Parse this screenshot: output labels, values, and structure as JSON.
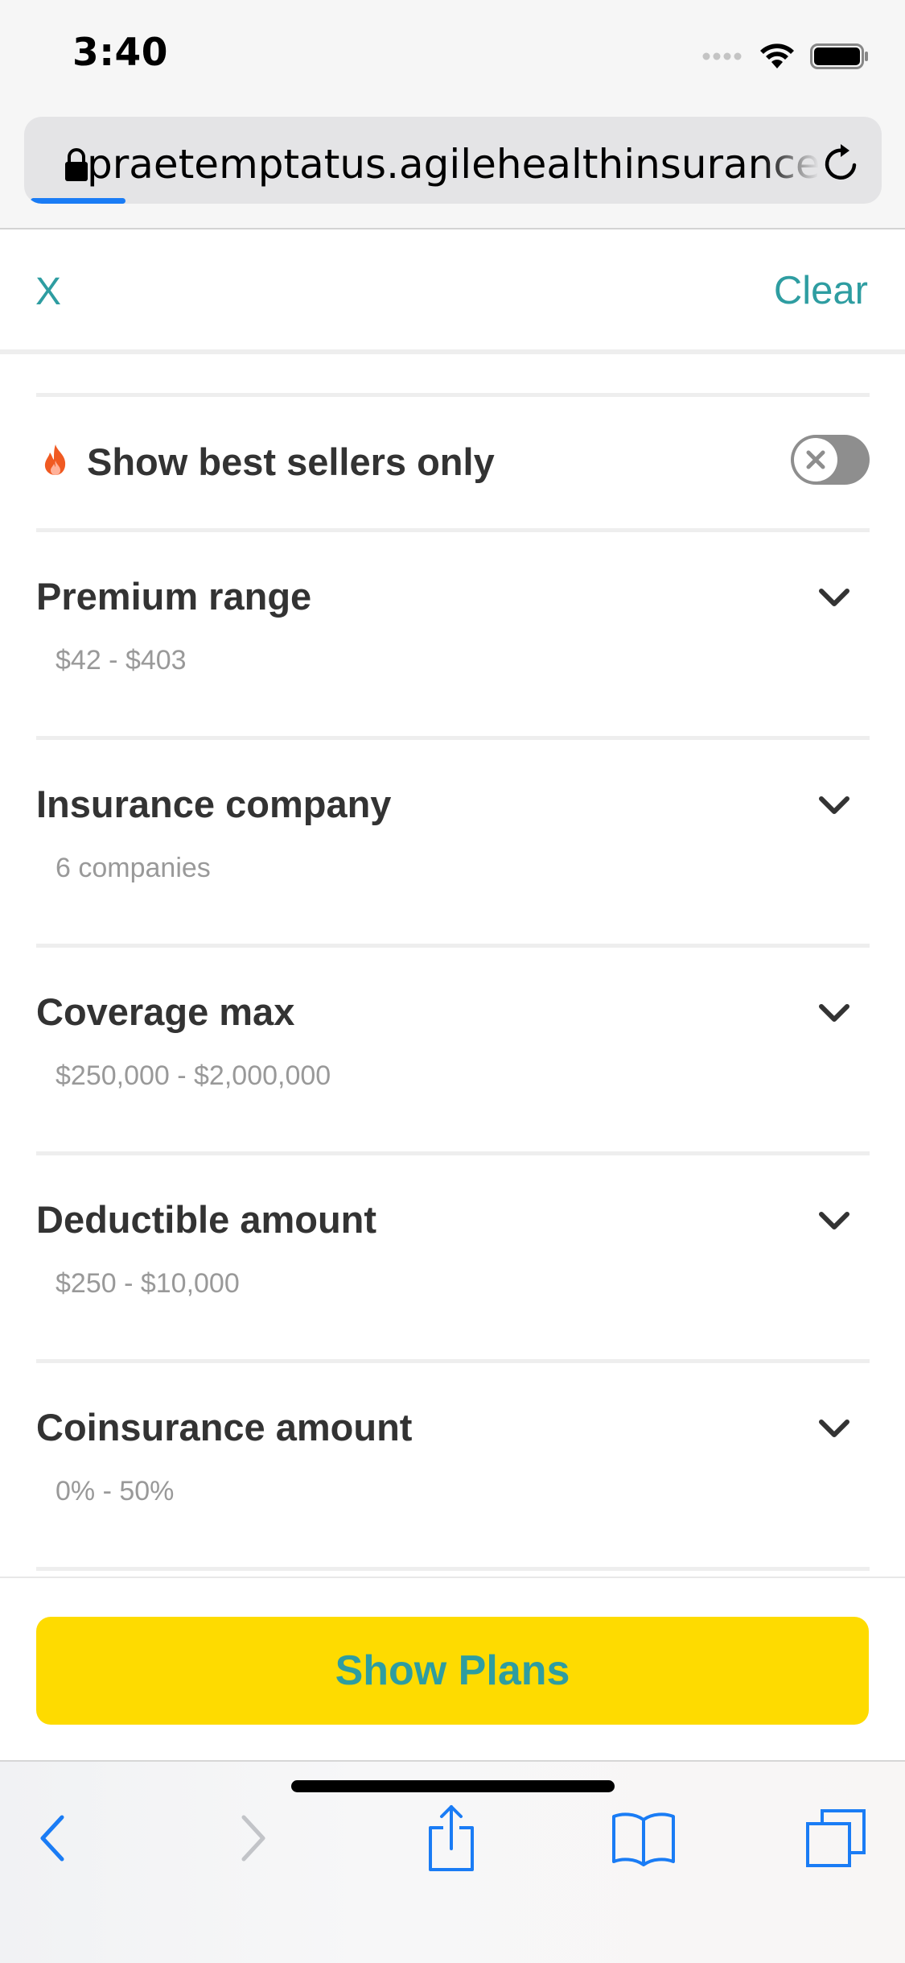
{
  "status_bar": {
    "time": "3:40"
  },
  "browser": {
    "url": "praetemptatus.agilehealthinsurance.com",
    "icons": {
      "lock": "lock-icon",
      "reload": "reload-icon"
    }
  },
  "header": {
    "close_label": "X",
    "clear_label": "Clear"
  },
  "best_sellers": {
    "label": "Show best sellers only",
    "enabled": false,
    "icon": "fire-icon"
  },
  "filters": [
    {
      "title": "Premium range",
      "summary": "$42 - $403"
    },
    {
      "title": "Insurance company",
      "summary": "6 companies"
    },
    {
      "title": "Coverage max",
      "summary": "$250,000 - $2,000,000"
    },
    {
      "title": "Deductible amount",
      "summary": "$250 - $10,000"
    },
    {
      "title": "Coinsurance amount",
      "summary": "0% - 50%"
    }
  ],
  "footer": {
    "button_label": "Show Plans"
  },
  "colors": {
    "accent_teal": "#2e9da1",
    "button_yellow": "#fedb00",
    "ios_blue": "#1a7cf5",
    "fire_orange": "#f05a22"
  },
  "toolbar": {
    "icons": [
      "back-icon",
      "forward-icon",
      "share-icon",
      "bookmarks-icon",
      "tabs-icon"
    ]
  }
}
